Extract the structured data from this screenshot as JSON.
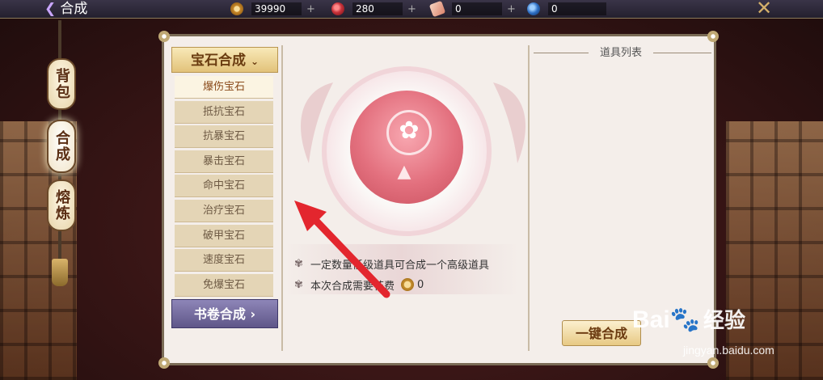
{
  "topbar": {
    "back_label": "合成",
    "resources": [
      {
        "icon": "coin-icon",
        "value": "39990",
        "plus": "+",
        "color": "#d9a441"
      },
      {
        "icon": "red-jade-icon",
        "value": "280",
        "plus": "+",
        "color": "#c8323a"
      },
      {
        "icon": "ticket-icon",
        "value": "0",
        "plus": "+",
        "color": "#e9b8a0"
      },
      {
        "icon": "blue-orb-icon",
        "value": "0",
        "plus": "",
        "color": "#2e6fc4"
      }
    ],
    "close_icon": "crossed-swords-icon"
  },
  "side_tabs": [
    {
      "label": "背包",
      "active": false
    },
    {
      "label": "合成",
      "active": true
    },
    {
      "label": "熔炼",
      "active": false
    }
  ],
  "left_menu": {
    "gem_header": "宝石合成",
    "gem_items": [
      "爆伤宝石",
      "抵抗宝石",
      "抗暴宝石",
      "暴击宝石",
      "命中宝石",
      "治疗宝石",
      "破甲宝石",
      "速度宝石",
      "免爆宝石"
    ],
    "selected_index": 0,
    "book_header": "书卷合成"
  },
  "center": {
    "info_line_1": "一定数量低级道具可合成一个高级道具",
    "info_line_2": "本次合成需要花费",
    "cost_value": "0",
    "emblem_icon": "family-crest-icon",
    "arrow_icon": "up-arrow-icon"
  },
  "right": {
    "title": "道具列表",
    "button_label": "一键合成"
  },
  "watermark": {
    "logo": "Bai",
    "logo_suffix": "经验",
    "url": "jingyan.baidu.com"
  },
  "colors": {
    "annotation_arrow": "#e3262e",
    "panel_bg": "#f4eeea",
    "header_gold": "#e2c27a",
    "header_purple": "#5f5688"
  }
}
